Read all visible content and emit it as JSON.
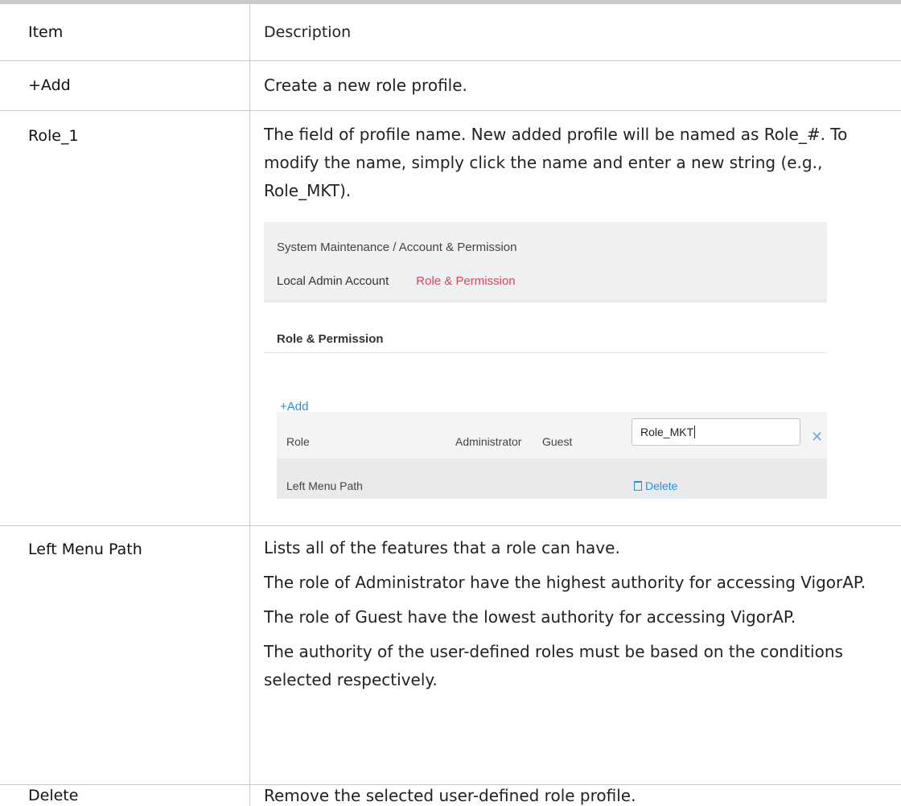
{
  "table": {
    "header": {
      "item": "Item",
      "description": "Description"
    },
    "rows": [
      {
        "item": "+Add",
        "description": [
          "Create a new role profile."
        ]
      },
      {
        "item": "Role_1",
        "description": [
          "The field of profile name. New added profile will be named as Role_#. To modify the name, simply click the name and enter a new string (e.g., Role_MKT)."
        ]
      },
      {
        "item": "Left Menu Path",
        "description": [
          "Lists all of the features that a role can have.",
          "The role of Administrator have the highest authority for accessing VigorAP.",
          "The role of Guest have the lowest authority for accessing VigorAP.",
          "The authority of the user-defined roles must be based on the conditions selected respectively."
        ]
      },
      {
        "item": "Delete",
        "description": [
          "Remove the selected user-defined role profile."
        ]
      }
    ]
  },
  "screenshot": {
    "breadcrumb": "System Maintenance / Account & Permission",
    "tabs": [
      {
        "label": "Local Admin Account",
        "active": false
      },
      {
        "label": "Role & Permission",
        "active": true
      }
    ],
    "panel_title": "Role & Permission",
    "add_label": "+Add",
    "columns": {
      "role": "Role",
      "administrator": "Administrator",
      "guest": "Guest"
    },
    "input_value": "Role_MKT",
    "menu_label": "Left Menu Path",
    "delete_label": "Delete",
    "icons": {
      "close": "close-icon",
      "trash": "trash-icon"
    },
    "colors": {
      "accent_tab": "#e0425c",
      "link": "#2a8fd8"
    }
  }
}
